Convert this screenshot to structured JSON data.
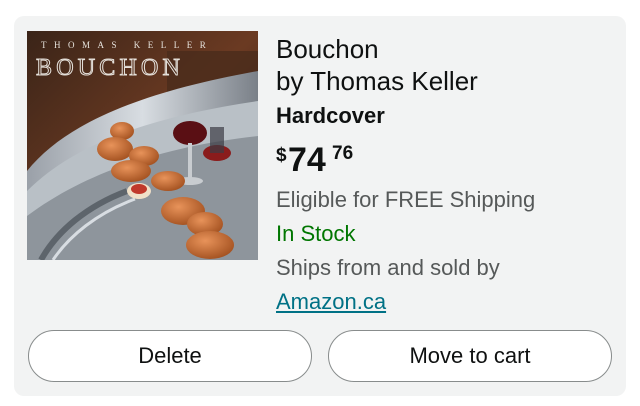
{
  "product": {
    "title_line1": "Bouchon",
    "title_line2": "by Thomas Keller",
    "format": "Hardcover",
    "price_symbol": "$",
    "price_whole": "74",
    "price_fraction": "76",
    "shipping": "Eligible for FREE Shipping",
    "stock_status": "In Stock",
    "ships_from": "Ships from and sold by",
    "seller": "Amazon.ca",
    "cover": {
      "author_text": "THOMAS KELLER",
      "title_text": "BOUCHON"
    }
  },
  "actions": {
    "delete_label": "Delete",
    "move_label": "Move to cart"
  },
  "colors": {
    "in_stock": "#007600",
    "link": "#007185",
    "card_bg": "#f2f3f3"
  }
}
